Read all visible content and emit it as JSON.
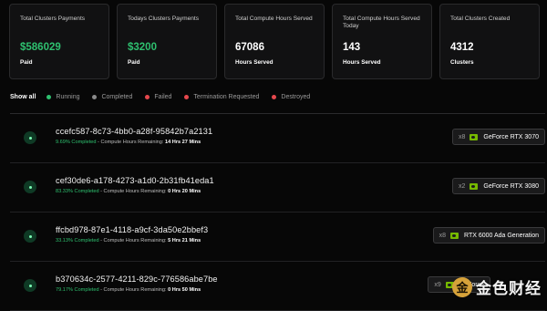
{
  "stats": [
    {
      "title": "Total Clusters Payments",
      "value": "$586029",
      "sub": "Paid",
      "green": true
    },
    {
      "title": "Todays Clusters Payments",
      "value": "$3200",
      "sub": "Paid",
      "green": true
    },
    {
      "title": "Total Compute Hours Served",
      "value": "67086",
      "sub": "Hours Served",
      "green": false
    },
    {
      "title": "Total Compute Hours Served Today",
      "value": "143",
      "sub": "Hours Served",
      "green": false
    },
    {
      "title": "Total Clusters Created",
      "value": "4312",
      "sub": "Clusters",
      "green": false
    }
  ],
  "filters": {
    "show_all": "Show all",
    "items": [
      {
        "label": "Running",
        "color": "#2ec06f"
      },
      {
        "label": "Completed",
        "color": "#8a8a8a"
      },
      {
        "label": "Failed",
        "color": "#e5484d"
      },
      {
        "label": "Termination Requested",
        "color": "#e5484d"
      },
      {
        "label": "Destroyed",
        "color": "#e5484d"
      }
    ]
  },
  "clusters": [
    {
      "id": "ccefc587-8c73-4bb0-a28f-95842b7a2131",
      "completed": "9.69% Completed",
      "remaining_label": " - Compute Hours Remaining: ",
      "remaining": "14 Hrs 27 Mins",
      "multiplier": "x8",
      "gpu": "GeForce RTX 3070"
    },
    {
      "id": "cef30de6-a178-4273-a1d0-2b31fb41eda1",
      "completed": "83.33% Completed",
      "remaining_label": " - Compute Hours Remaining: ",
      "remaining": "0 Hrs 20 Mins",
      "multiplier": "x2",
      "gpu": "GeForce RTX 3080"
    },
    {
      "id": "ffcbd978-87e1-4118-a9cf-3da50e2bbef3",
      "completed": "33.13% Completed",
      "remaining_label": " - Compute Hours Remaining: ",
      "remaining": "5 Hrs 21 Mins",
      "multiplier": "x8",
      "gpu": "RTX 6000 Ada Generation"
    },
    {
      "id": "b370634c-2577-4211-829c-776586abe7be",
      "completed": "79.17% Completed",
      "remaining_label": " - Compute Hours Remaining: ",
      "remaining": "0 Hrs 50 Mins",
      "multiplier": "x9",
      "gpu": "GeForce"
    }
  ],
  "watermark": {
    "text": "金色财经",
    "logo": "金"
  },
  "colors": {
    "accent_green": "#2ec06f",
    "background": "#070707",
    "card": "#111112"
  }
}
